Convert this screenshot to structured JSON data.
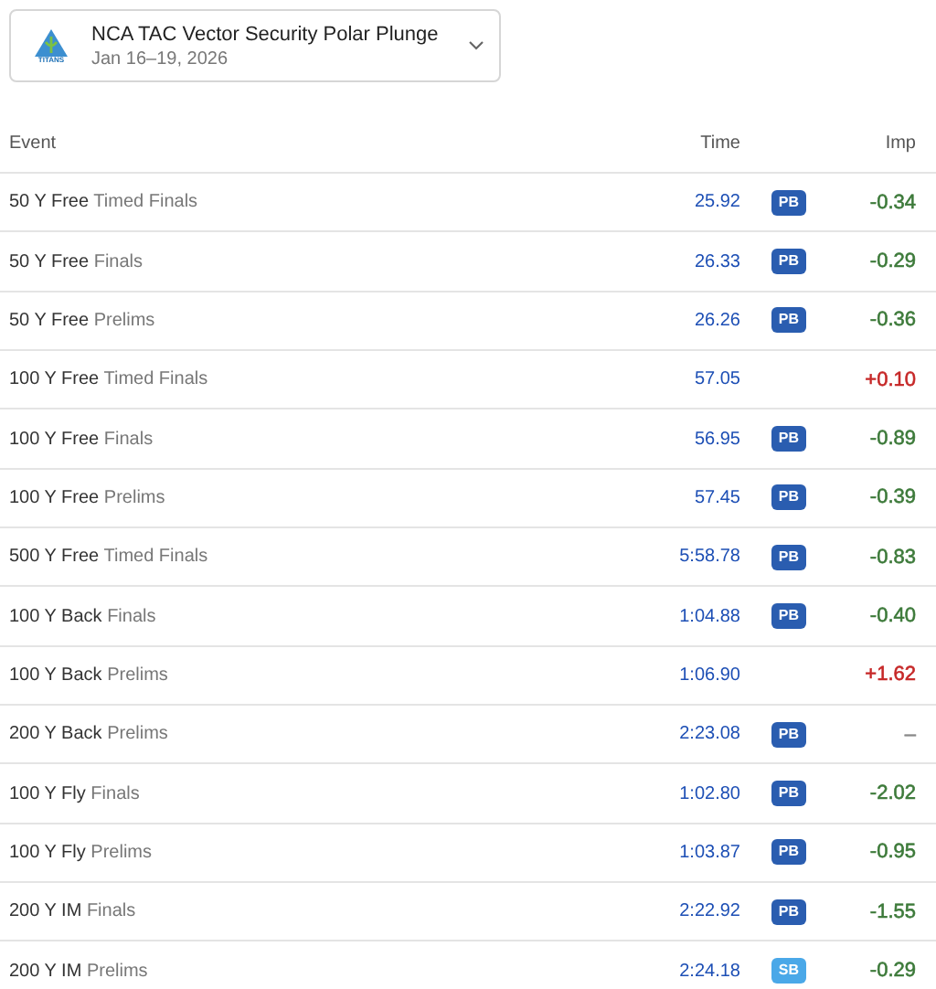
{
  "meet": {
    "title": "NCA TAC Vector Security Polar Plunge",
    "dates": "Jan 16–19, 2026",
    "logo_text": "TITANS"
  },
  "table": {
    "columns": [
      "Event",
      "Time",
      "Imp"
    ],
    "rows": [
      {
        "event": "50 Y Free",
        "round": "Timed Finals",
        "time": "25.92",
        "badge": {
          "text": "PB",
          "color": "#2a5db0"
        },
        "imp": {
          "text": "-0.34",
          "color": "#3d7a3a"
        }
      },
      {
        "event": "50 Y Free",
        "round": "Finals",
        "time": "26.33",
        "badge": {
          "text": "PB",
          "color": "#2a5db0"
        },
        "imp": {
          "text": "-0.29",
          "color": "#3d7a3a"
        }
      },
      {
        "event": "50 Y Free",
        "round": "Prelims",
        "time": "26.26",
        "badge": {
          "text": "PB",
          "color": "#2a5db0"
        },
        "imp": {
          "text": "-0.36",
          "color": "#3d7a3a"
        }
      },
      {
        "event": "100 Y Free",
        "round": "Timed Finals",
        "time": "57.05",
        "imp": {
          "text": "+0.10",
          "color": "#c62828"
        }
      },
      {
        "event": "100 Y Free",
        "round": "Finals",
        "time": "56.95",
        "badge": {
          "text": "PB",
          "color": "#2a5db0"
        },
        "imp": {
          "text": "-0.89",
          "color": "#3d7a3a"
        }
      },
      {
        "event": "100 Y Free",
        "round": "Prelims",
        "time": "57.45",
        "badge": {
          "text": "PB",
          "color": "#2a5db0"
        },
        "imp": {
          "text": "-0.39",
          "color": "#3d7a3a"
        }
      },
      {
        "event": "500 Y Free",
        "round": "Timed Finals",
        "time": "5:58.78",
        "badge": {
          "text": "PB",
          "color": "#2a5db0"
        },
        "imp": {
          "text": "-0.83",
          "color": "#3d7a3a"
        }
      },
      {
        "event": "100 Y Back",
        "round": "Finals",
        "time": "1:04.88",
        "badge": {
          "text": "PB",
          "color": "#2a5db0"
        },
        "imp": {
          "text": "-0.40",
          "color": "#3d7a3a"
        }
      },
      {
        "event": "100 Y Back",
        "round": "Prelims",
        "time": "1:06.90",
        "imp": {
          "text": "+1.62",
          "color": "#c62828"
        }
      },
      {
        "event": "200 Y Back",
        "round": "Prelims",
        "time": "2:23.08",
        "badge": {
          "text": "PB",
          "color": "#2a5db0"
        },
        "imp": {
          "text": "–",
          "color": "#8a8a8a"
        }
      },
      {
        "event": "100 Y Fly",
        "round": "Finals",
        "time": "1:02.80",
        "badge": {
          "text": "PB",
          "color": "#2a5db0"
        },
        "imp": {
          "text": "-2.02",
          "color": "#3d7a3a"
        }
      },
      {
        "event": "100 Y Fly",
        "round": "Prelims",
        "time": "1:03.87",
        "badge": {
          "text": "PB",
          "color": "#2a5db0"
        },
        "imp": {
          "text": "-0.95",
          "color": "#3d7a3a"
        }
      },
      {
        "event": "200 Y IM",
        "round": "Finals",
        "time": "2:22.92",
        "badge": {
          "text": "PB",
          "color": "#2a5db0"
        },
        "imp": {
          "text": "-1.55",
          "color": "#3d7a3a"
        }
      },
      {
        "event": "200 Y IM",
        "round": "Prelims",
        "time": "2:24.18",
        "badge": {
          "text": "SB",
          "color": "#4aa8e8"
        },
        "imp": {
          "text": "-0.29",
          "color": "#3d7a3a"
        }
      }
    ]
  }
}
